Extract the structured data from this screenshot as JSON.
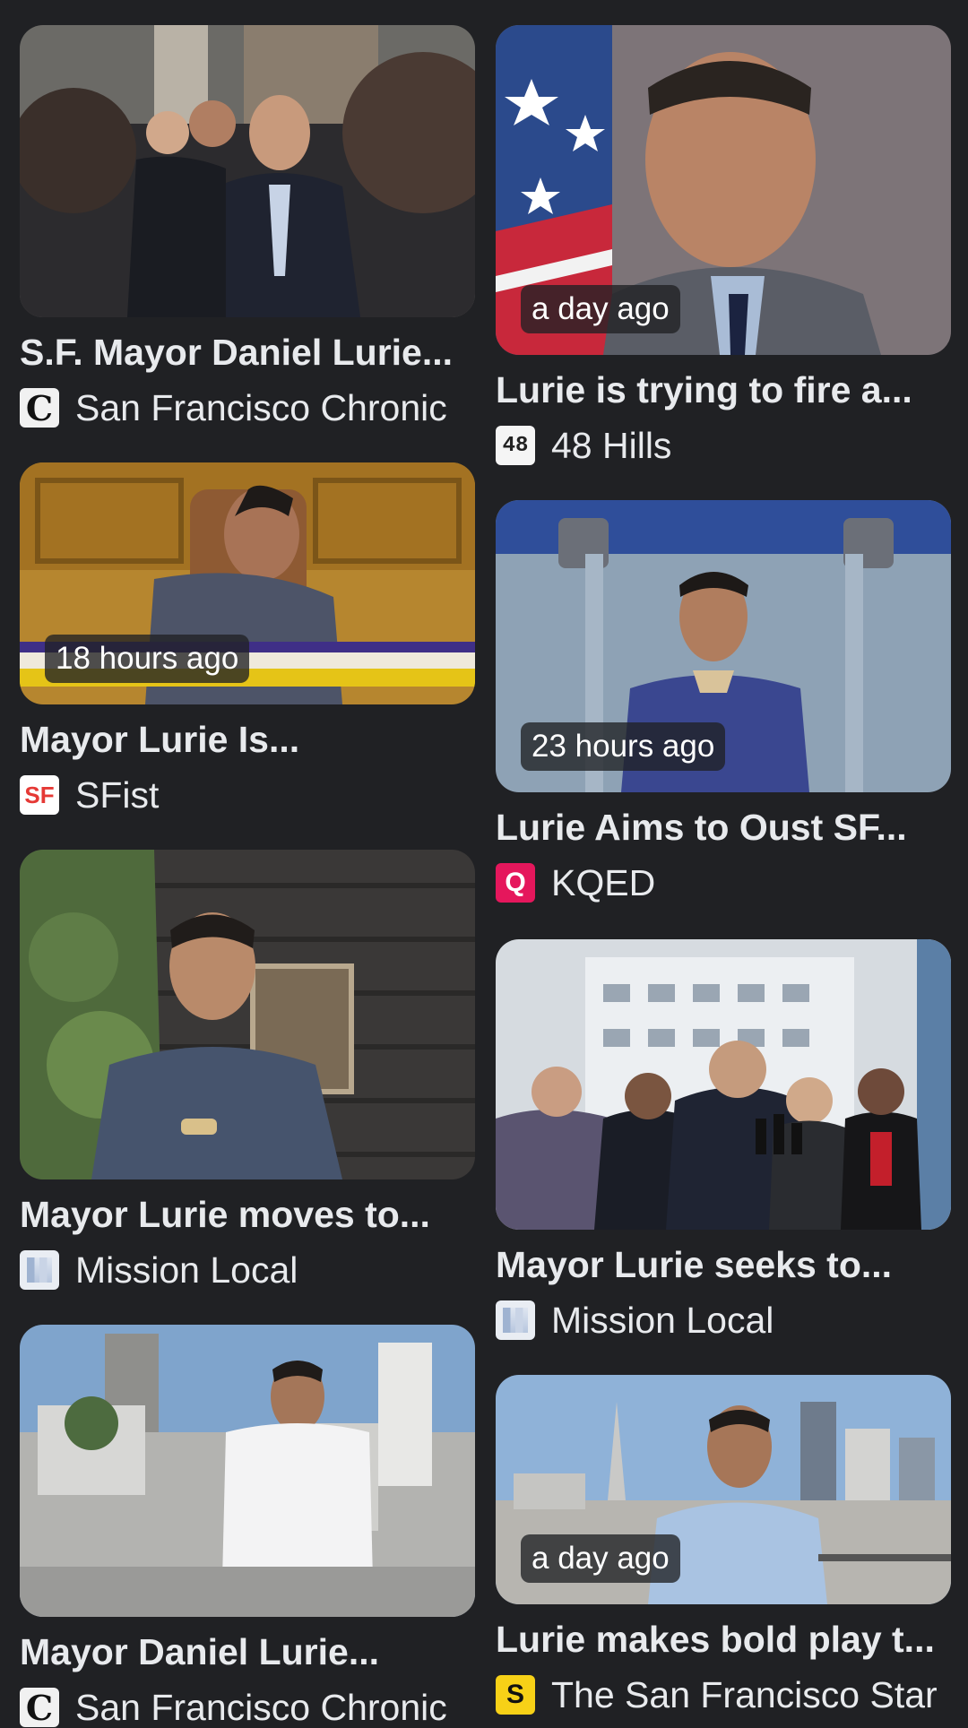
{
  "cards": [
    {
      "title": "S.F. Mayor Daniel Lurie...",
      "source": "San Francisco Chronic",
      "time": "",
      "favicon": "chronicle-favicon",
      "favicon_text": "C"
    },
    {
      "title": "Lurie is trying to fire a...",
      "source": "48 Hills",
      "time": "a day ago",
      "favicon": "48hills-favicon",
      "favicon_text": "48"
    },
    {
      "title": "Mayor Lurie Is...",
      "source": "SFist",
      "time": "18 hours ago",
      "favicon": "sfist-favicon",
      "favicon_text": "SF"
    },
    {
      "title": "Lurie Aims to Oust SF...",
      "source": "KQED",
      "time": "23 hours ago",
      "favicon": "kqed-favicon",
      "favicon_text": "Q"
    },
    {
      "title": "Mayor Lurie moves to...",
      "source": "Mission Local",
      "time": "",
      "favicon": "mission-local-favicon",
      "favicon_text": ""
    },
    {
      "title": "Mayor Lurie seeks to...",
      "source": "Mission Local",
      "time": "",
      "favicon": "mission-local-favicon",
      "favicon_text": ""
    },
    {
      "title": "Mayor Daniel Lurie...",
      "source": "San Francisco Chronic",
      "time": "",
      "favicon": "chronicle-favicon",
      "favicon_text": "C"
    },
    {
      "title": "Lurie makes bold play t...",
      "source": "The San Francisco Star",
      "time": "a day ago",
      "favicon": "sf-star-favicon",
      "favicon_text": "S"
    }
  ],
  "colors": {
    "background": "#202124",
    "text": "#e8eaed",
    "badge_bg": "rgba(32,33,36,0.78)"
  }
}
